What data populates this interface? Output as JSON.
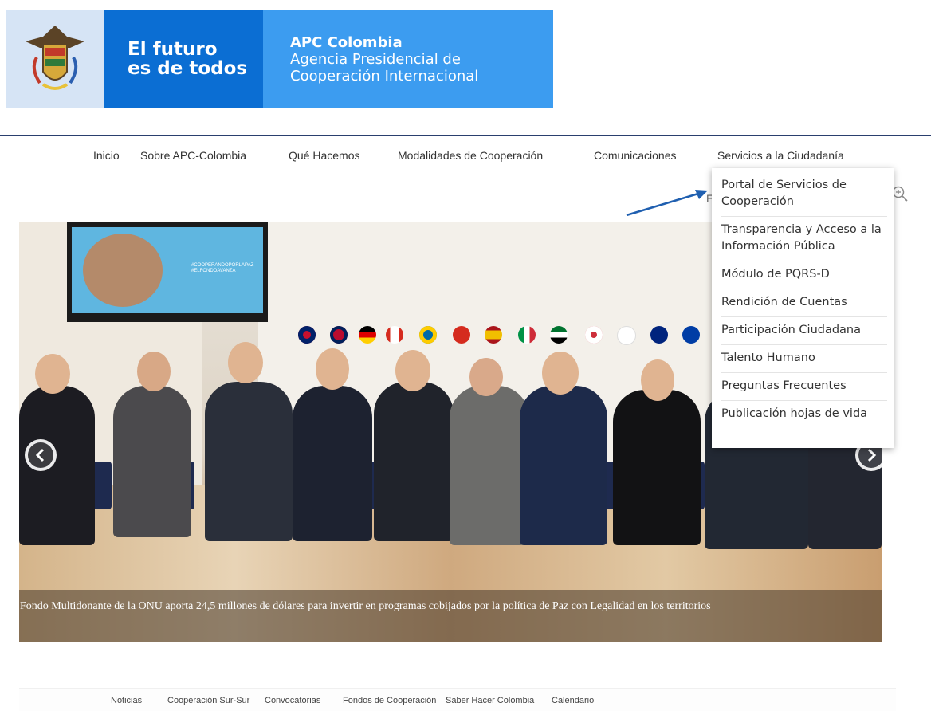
{
  "header": {
    "slogan_line1": "El futuro",
    "slogan_line2": "es de todos",
    "org_line1": "APC Colombia",
    "org_line2": "Agencia Presidencial de",
    "org_line3": "Cooperación Internacional",
    "colors": {
      "dark_blue": "#0b6ed3",
      "light_blue": "#3c9cf0",
      "seal_bg": "#d6e4f5"
    }
  },
  "main_nav": {
    "items": [
      {
        "label": "Inicio"
      },
      {
        "label": "Sobre APC-Colombia"
      },
      {
        "label": "Qué Hacemos"
      },
      {
        "label": "Modalidades de Cooperación"
      },
      {
        "label": "Comunicaciones"
      },
      {
        "label": "Servicios a la Ciudadanía"
      }
    ]
  },
  "dropdown": {
    "items": [
      {
        "label": "Portal de Servicios de Cooperación"
      },
      {
        "label": "Transparencia y Acceso a la Información Pública"
      },
      {
        "label": "Módulo de PQRS-D"
      },
      {
        "label": "Rendición de Cuentas"
      },
      {
        "label": "Participación Ciudadana"
      },
      {
        "label": "Talento Humano"
      },
      {
        "label": "Preguntas Frecuentes"
      },
      {
        "label": "Publicación hojas de vida"
      }
    ]
  },
  "peek_letter": "E",
  "slider": {
    "caption": "Fondo Multidonante de la ONU aporta 24,5 millones de dólares para invertir en programas cobijados por la política de Paz con Legalidad en los territorios",
    "tv_text": "#COOPERANDOPORLAPAZ #ELFONDOAVANZA",
    "prev_icon": "chevron-left-icon",
    "next_icon": "chevron-right-icon"
  },
  "bottom_nav": {
    "items": [
      {
        "label": "Noticias"
      },
      {
        "label": "Cooperación Sur-Sur"
      },
      {
        "label": "Convocatorias"
      },
      {
        "label": "Fondos de Cooperación"
      },
      {
        "label": "Saber Hacer Colombia"
      },
      {
        "label": "Calendario"
      }
    ]
  },
  "annotation_arrow_color": "#1f5fb0"
}
